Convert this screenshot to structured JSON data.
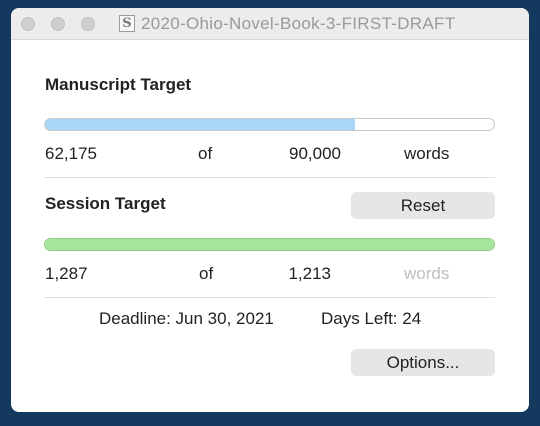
{
  "window": {
    "title": "2020-Ohio-Novel-Book-3-FIRST-DRAFT",
    "doc_icon_glyph": "S"
  },
  "manuscript": {
    "heading": "Manuscript Target",
    "current": "62,175",
    "of_label": "of",
    "target": "90,000",
    "unit": "words",
    "progress_fraction": 0.69,
    "fill_color": "#a7d6f7"
  },
  "session": {
    "heading": "Session Target",
    "reset_label": "Reset",
    "current": "1,287",
    "of_label": "of",
    "target": "1,213",
    "unit": "words",
    "progress_fraction": 1.0,
    "fill_color": "#a6e59d"
  },
  "footer": {
    "deadline": "Deadline: Jun 30, 2021",
    "days_left": "Days Left: 24",
    "options_label": "Options..."
  }
}
